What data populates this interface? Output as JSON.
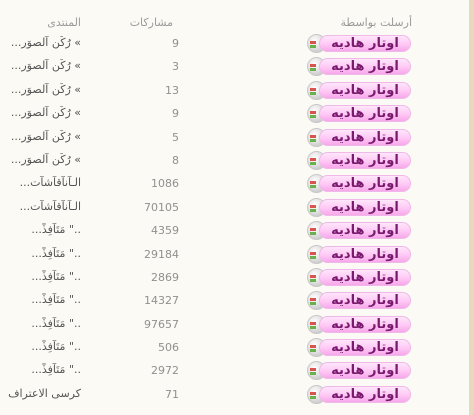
{
  "header": {
    "sender": "أرسلت بواسطة",
    "posts": "مشاركات",
    "forum": "المنتدى"
  },
  "rows": [
    {
      "forum": "» رُكْن آلصوَر...",
      "posts": "9",
      "sender": "اوتار هاديه"
    },
    {
      "forum": "» رُكْن آلصوَر...",
      "posts": "3",
      "sender": "اوتار هاديه"
    },
    {
      "forum": "» رُكْن آلصوَر...",
      "posts": "13",
      "sender": "اوتار هاديه"
    },
    {
      "forum": "» رُكْن آلصوَر...",
      "posts": "9",
      "sender": "اوتار هاديه"
    },
    {
      "forum": "» رُكْن آلصوَر...",
      "posts": "5",
      "sender": "اوتار هاديه"
    },
    {
      "forum": "» رُكْن آلصوَر...",
      "posts": "8",
      "sender": "اوتار هاديه"
    },
    {
      "forum": "الـآنآقآشآت...",
      "posts": "1086",
      "sender": "اوتار هاديه"
    },
    {
      "forum": "الـآنآقآشآت...",
      "posts": "70105",
      "sender": "اوتار هاديه"
    },
    {
      "forum": "..\" مَتَآفِذْ...",
      "posts": "4359",
      "sender": "اوتار هاديه"
    },
    {
      "forum": "..\" مَتَآفِذْ...",
      "posts": "29184",
      "sender": "اوتار هاديه"
    },
    {
      "forum": "..\" مَتَآفِذْ...",
      "posts": "2869",
      "sender": "اوتار هاديه"
    },
    {
      "forum": "..\" مَتَآفِذْ...",
      "posts": "14327",
      "sender": "اوتار هاديه"
    },
    {
      "forum": "..\" مَتَآفِذْ...",
      "posts": "97657",
      "sender": "اوتار هاديه"
    },
    {
      "forum": "..\" مَتَآفِذْ...",
      "posts": "506",
      "sender": "اوتار هاديه"
    },
    {
      "forum": "..\" مَتَآفِذْ...",
      "posts": "2972",
      "sender": "اوتار هاديه"
    },
    {
      "forum": "كرسى الاعتراف",
      "posts": "71",
      "sender": "اوتار هاديه"
    }
  ],
  "colors": {
    "background": "#fbfaf4",
    "pill_text": "#7a1a6e",
    "pill_fill": "#ffc8f5"
  },
  "icons": {
    "avatar": "user-avatar-icon"
  }
}
